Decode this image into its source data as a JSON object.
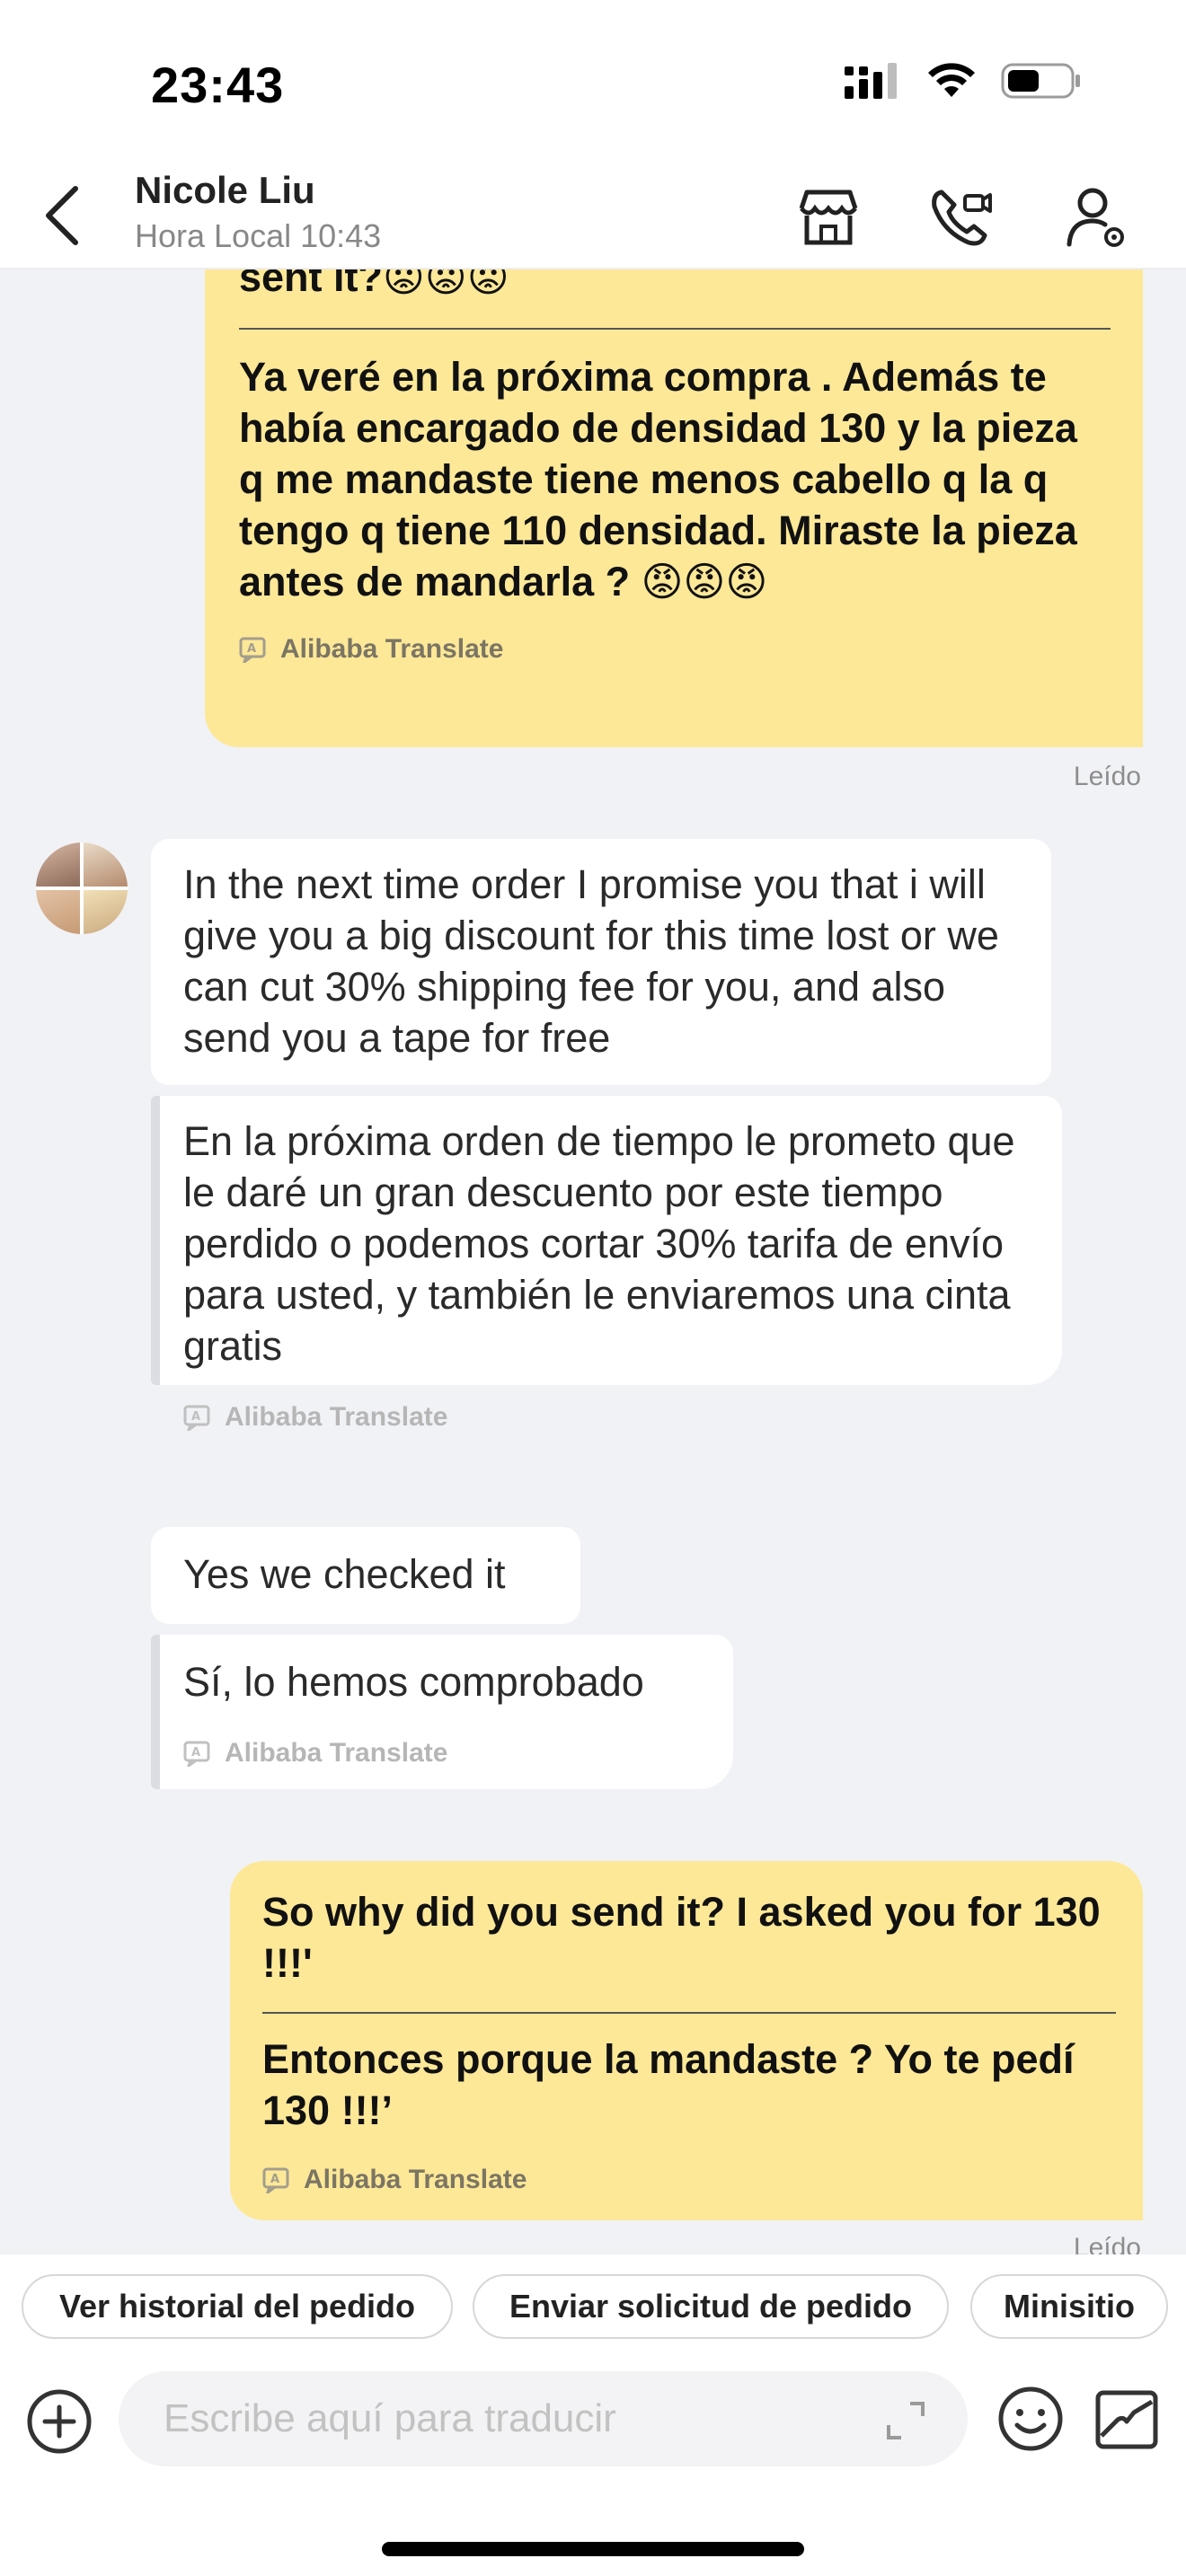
{
  "status_bar": {
    "time": "23:43"
  },
  "header": {
    "name": "Nicole Liu",
    "subtitle": "Hora Local 10:43"
  },
  "icons": {
    "back": "chevron-left-icon",
    "store": "store-icon",
    "video_call": "video-call-icon",
    "profile": "profile-settings-icon",
    "translate": "translate-icon",
    "add": "plus-circle-icon",
    "expand": "expand-icon",
    "emoji": "emoji-icon",
    "image": "image-icon"
  },
  "messages": {
    "m1": {
      "original_tail": "sent it?😡😡😡",
      "translated": "Ya veré en la próxima compra . Además te había encargado de densidad 130 y la pieza q me mandaste tiene menos cabello q la q tengo q tiene 110 densidad. Miraste la pieza antes de mandarla ? 😡😡😡",
      "translate_label": "Alibaba Translate",
      "status": "Leído"
    },
    "m2": {
      "original": "In the next time order I promise you that i will give you a big discount for this time lost or we can cut 30% shipping fee for you, and also send you a tape for free",
      "translated": "En la próxima orden de tiempo le prometo que le daré un gran descuento por este tiempo perdido o podemos cortar 30% tarifa de envío para usted, y también le enviaremos una cinta gratis",
      "translate_label": "Alibaba Translate"
    },
    "m3": {
      "original": "Yes we checked it",
      "translated": "Sí, lo hemos comprobado",
      "translate_label": "Alibaba Translate"
    },
    "m4": {
      "original": "So why did you send it? I asked you for 130 !!!'",
      "translated": "Entonces porque la mandaste ? Yo te pedí 130 !!!’",
      "translate_label": "Alibaba Translate",
      "status": "Leído"
    }
  },
  "quick_actions": [
    "Ver historial del pedido",
    "Enviar solicitud de pedido",
    "Minisitio"
  ],
  "input": {
    "placeholder": "Escribe aquí para traducir"
  },
  "colors": {
    "my_bubble": "#fde898",
    "chat_bg": "#f1f2f6",
    "their_bubble": "#ffffff"
  }
}
